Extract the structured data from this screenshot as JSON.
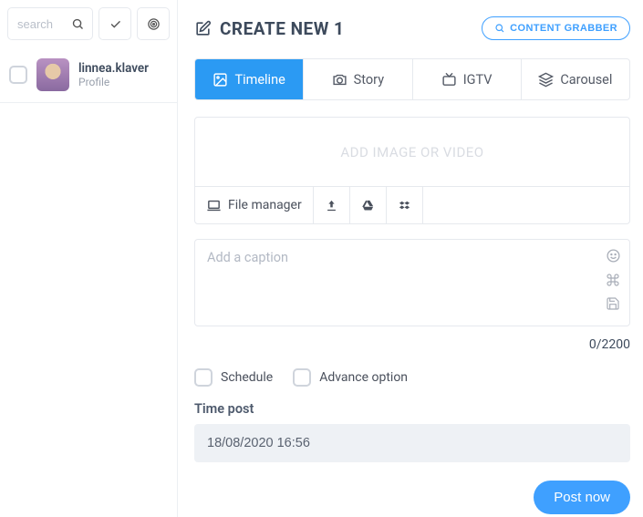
{
  "sidebar": {
    "search_placeholder": "search",
    "account": {
      "name": "linnea.klaver",
      "role": "Profile"
    }
  },
  "header": {
    "title": "CREATE NEW 1",
    "grabber": "CONTENT GRABBER"
  },
  "tabs": {
    "timeline": "Timeline",
    "story": "Story",
    "igtv": "IGTV",
    "carousel": "Carousel"
  },
  "media": {
    "drop_label": "ADD IMAGE OR VIDEO",
    "file_manager": "File manager"
  },
  "caption": {
    "placeholder": "Add a caption",
    "counter": "0/2200"
  },
  "options": {
    "schedule": "Schedule",
    "advance": "Advance option"
  },
  "time_post": {
    "label": "Time post",
    "value": "18/08/2020 16:56"
  },
  "actions": {
    "post_now": "Post now"
  }
}
